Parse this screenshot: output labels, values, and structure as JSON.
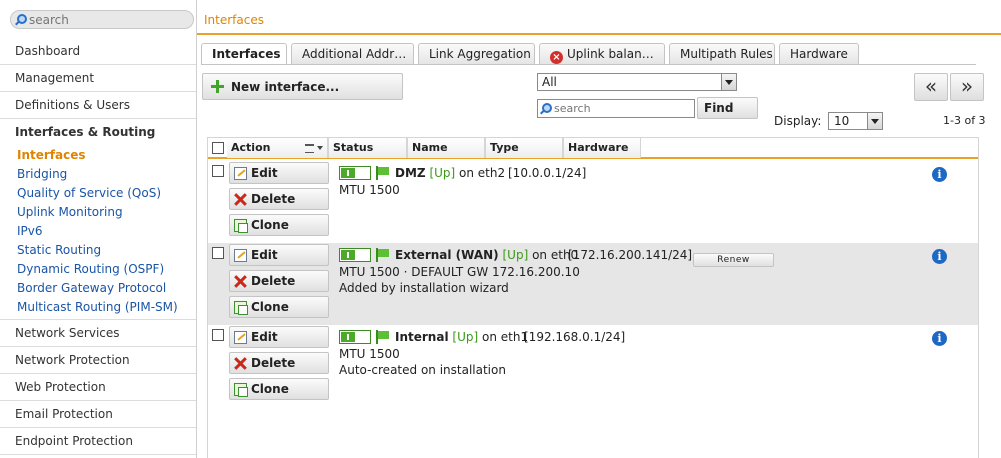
{
  "sidebar": {
    "search_placeholder": "search",
    "items_top": [
      "Dashboard",
      "Management",
      "Definitions & Users"
    ],
    "open_category": "Interfaces & Routing",
    "sub_items": [
      "Interfaces",
      "Bridging",
      "Quality of Service (QoS)",
      "Uplink Monitoring",
      "IPv6",
      "Static Routing",
      "Dynamic Routing (OSPF)",
      "Border Gateway Protocol",
      "Multicast Routing (PIM-SM)"
    ],
    "active_sub": "Interfaces",
    "items_bottom": [
      "Network Services",
      "Network Protection",
      "Web Protection",
      "Email Protection",
      "Endpoint Protection"
    ]
  },
  "header": {
    "title": "Interfaces"
  },
  "tabs": [
    {
      "label": "Interfaces",
      "active": true
    },
    {
      "label": "Additional Addr…",
      "active": false
    },
    {
      "label": "Link Aggregation",
      "active": false
    },
    {
      "label": "Uplink balan…",
      "active": false,
      "warning": true
    },
    {
      "label": "Multipath Rules",
      "active": false
    },
    {
      "label": "Hardware",
      "active": false
    }
  ],
  "toolbar": {
    "new_label": "New interface...",
    "filter_value": "All",
    "search_placeholder": "search",
    "find_label": "Find",
    "prev_label": "«",
    "next_label": "»",
    "display_label": "Display:",
    "display_value": "10",
    "range_text": "1-3 of 3"
  },
  "table": {
    "columns": [
      "Action",
      "Status",
      "Name",
      "Type",
      "Hardware"
    ],
    "buttons": {
      "edit": "Edit",
      "delete": "Delete",
      "clone": "Clone"
    },
    "renew_label": "Renew",
    "info_glyph": "i",
    "rows": [
      {
        "name": "DMZ",
        "state": "[Up]",
        "on": "on eth2",
        "address": "[10.0.0.1/24]",
        "line2": "MTU 1500",
        "line3": ""
      },
      {
        "name": "External (WAN)",
        "state": "[Up]",
        "on": "on eth0",
        "address": "[172.16.200.141/24]",
        "line2": "MTU 1500 · DEFAULT GW 172.16.200.10",
        "line3": "Added by installation wizard",
        "renew": true
      },
      {
        "name": "Internal",
        "state": "[Up]",
        "on": "on eth1",
        "address": "[192.168.0.1/24]",
        "line2": "MTU 1500",
        "line3": "Auto-created on installation"
      }
    ]
  },
  "colors": {
    "accent": "#e9a225",
    "active_nav": "#e08400",
    "link": "#1a55a5",
    "status_up": "#3a9a17"
  }
}
